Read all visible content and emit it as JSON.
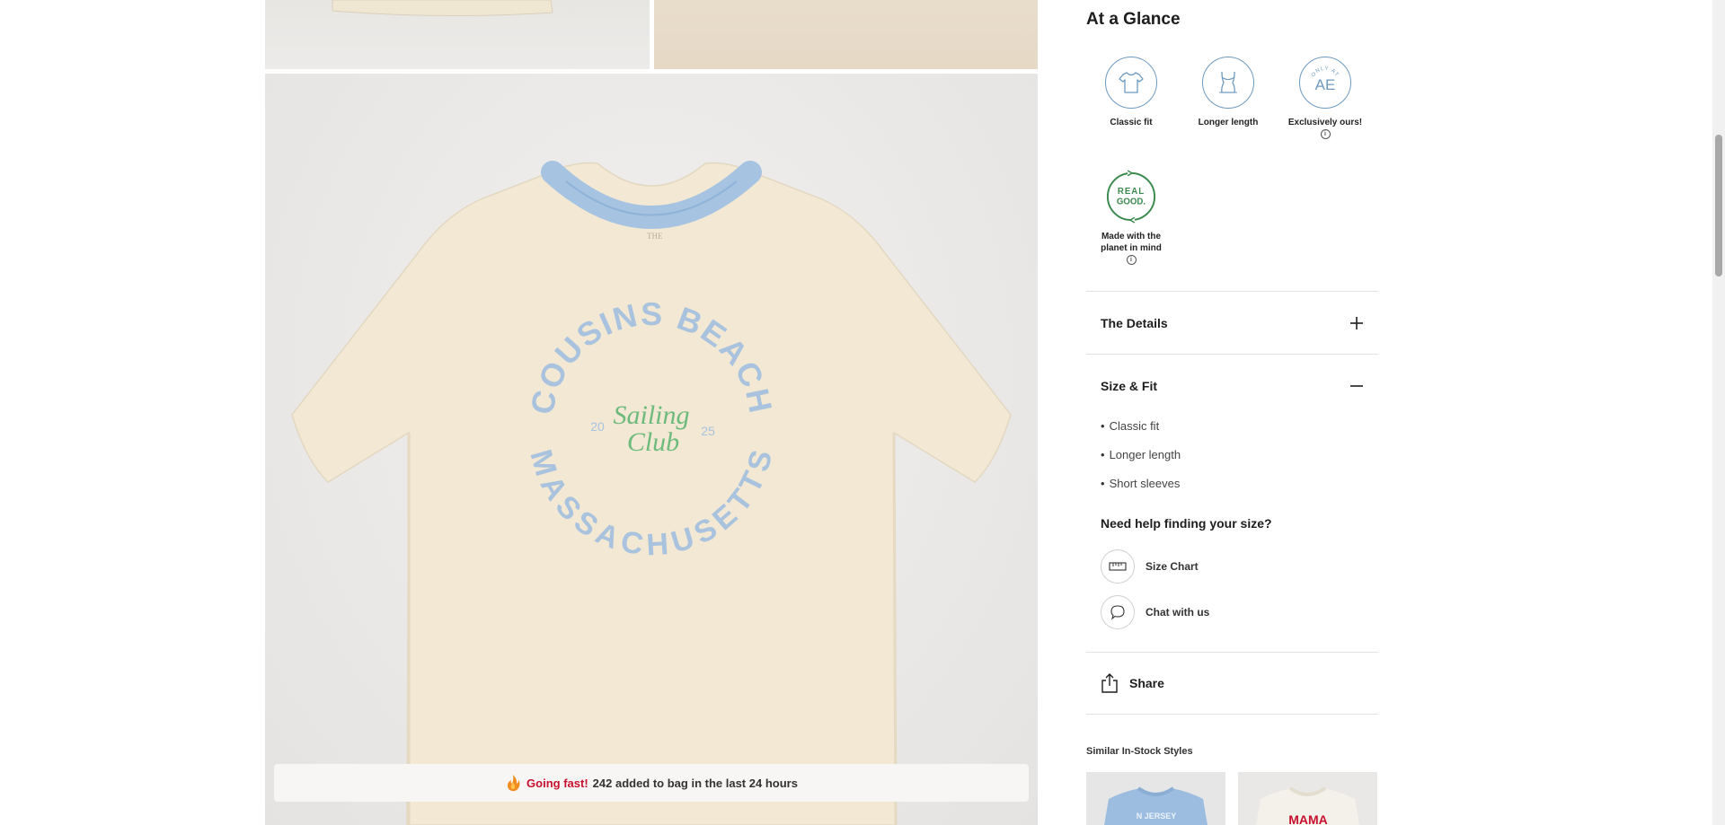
{
  "gallery": {
    "going_fast": {
      "hot_label": "Going fast!",
      "message": "242 added to bag in the last 24 hours"
    },
    "shirt_print": {
      "arc_top": "COUSINS BEACH",
      "arc_bottom": "MASSACHUSETTS",
      "script_line1": "Sailing",
      "script_line2": "Club",
      "year_left": "20",
      "year_right": "25",
      "tag_text": "THE"
    }
  },
  "at_a_glance": {
    "title": "At a Glance",
    "badges": [
      {
        "label": "Classic fit",
        "icon": "tshirt-icon"
      },
      {
        "label": "Longer length",
        "icon": "body-length-icon"
      },
      {
        "label": "Exclusively ours!",
        "icon": "only-at-ae-icon",
        "badge_top": "ONLY AT",
        "badge_main": "AE"
      },
      {
        "label": "Made with the planet in mind",
        "icon": "real-good-icon",
        "badge_line1": "REAL",
        "badge_line2": "GOOD."
      }
    ]
  },
  "accordions": {
    "details": {
      "title": "The Details"
    },
    "size_fit": {
      "title": "Size & Fit",
      "bullets": [
        "Classic fit",
        "Longer length",
        "Short sleeves"
      ]
    }
  },
  "size_help": {
    "title": "Need help finding your size?",
    "size_chart": "Size Chart",
    "chat": "Chat with us"
  },
  "share": {
    "label": "Share"
  },
  "similar": {
    "title": "Similar In-Stock Styles"
  },
  "colors": {
    "accent_blue": "#6e9ac0",
    "eco_green": "#3a8a4f",
    "urgency_red": "#c8102e"
  }
}
